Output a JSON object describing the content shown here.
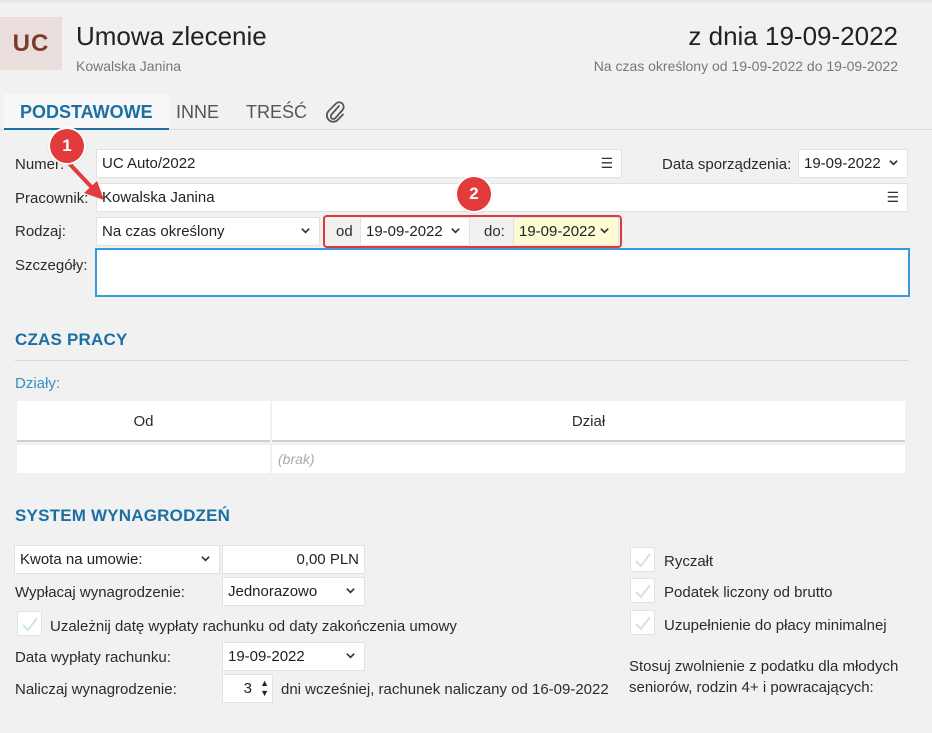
{
  "header": {
    "badge": "UC",
    "title": "Umowa zlecenie",
    "employee": "Kowalska Janina",
    "date_title": "z dnia 19-09-2022",
    "period": "Na czas określony od 19-09-2022 do 19-09-2022"
  },
  "tabs": [
    {
      "label": "PODSTAWOWE",
      "active": true
    },
    {
      "label": "INNE"
    },
    {
      "label": "TREŚĆ"
    },
    {
      "label": "attachment-icon"
    }
  ],
  "form": {
    "numer_label": "Numer:",
    "numer_value": "UC Auto/2022",
    "data_sporz_label": "Data sporządzenia:",
    "data_sporz_value": "19-09-2022",
    "pracownik_label": "Pracownik:",
    "pracownik_value": "Kowalska Janina",
    "rodzaj_label": "Rodzaj:",
    "rodzaj_value": "Na czas określony",
    "od_label": "od",
    "od_value": "19-09-2022",
    "do_label": "do:",
    "do_value": "19-09-2022",
    "szczegoly_label": "Szczegóły:",
    "szczegoly_value": ""
  },
  "annotations": [
    "1",
    "2"
  ],
  "czas_pracy": {
    "title": "CZAS PRACY",
    "dzialy_label": "Działy:",
    "columns": [
      "Od",
      "Dział"
    ],
    "empty_text": "(brak)"
  },
  "system": {
    "title": "SYSTEM WYNAGRODZEŃ",
    "kwota_select": "Kwota na umowie:",
    "kwota_value": "0,00 PLN",
    "wyplacaj_label": "Wypłacaj wynagrodzenie:",
    "wyplacaj_value": "Jednorazowo",
    "uzaleznij_label": "Uzależnij datę wypłaty rachunku od daty zakończenia umowy",
    "data_wyplaty_label": "Data wypłaty rachunku:",
    "data_wyplaty_value": "19-09-2022",
    "naliczaj_label": "Naliczaj wynagrodzenie:",
    "naliczaj_value": "3",
    "naliczaj_suffix": "dni wcześniej, rachunek naliczany od 16-09-2022",
    "ryczalt": "Ryczałt",
    "podatek_brutto": "Podatek liczony od brutto",
    "uzupelnienie": "Uzupełnienie do płacy minimalnej",
    "zwolnienie": "Stosuj zwolnienie z podatku dla młodych seniorów, rodzin 4+ i powracających:"
  },
  "colors": {
    "accent": "#1c6fa3",
    "annotation": "#e23b3b",
    "highlight": "#fdfbd3",
    "badge_bg": "#e9dedb",
    "badge_fg": "#7a3b2c"
  }
}
